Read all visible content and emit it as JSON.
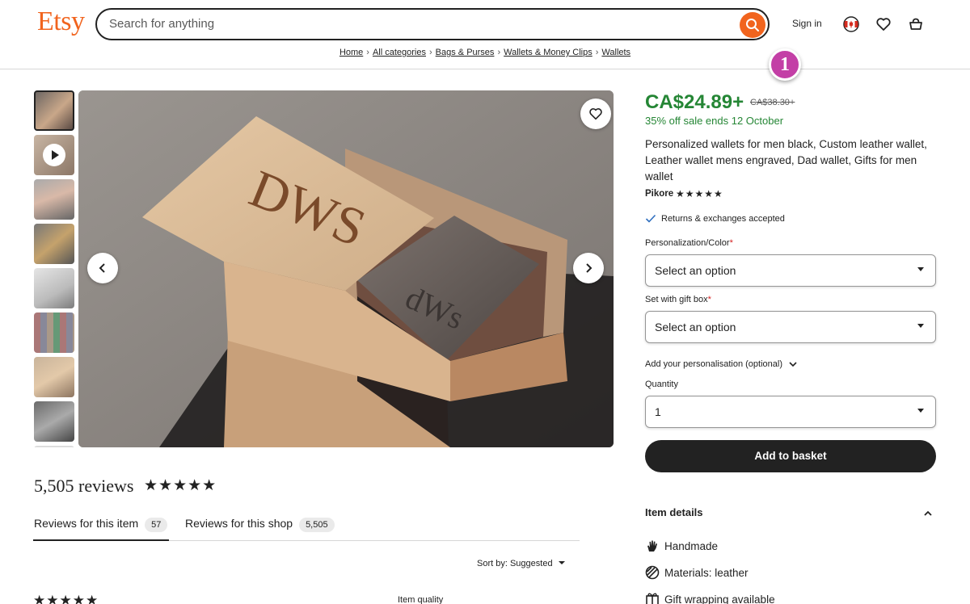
{
  "header": {
    "logo": "Etsy",
    "search_placeholder": "Search for anything",
    "signin": "Sign in"
  },
  "breadcrumb": [
    "Home",
    "All categories",
    "Bags & Purses",
    "Wallets & Money Clips",
    "Wallets"
  ],
  "marker_label": "1",
  "product": {
    "price": "CA$24.89+",
    "original_price": "CA$38.30+",
    "sale_text": "35% off sale ends 12 October",
    "title": "Personalized wallets for men black, Custom leather wallet, Leather wallet mens engraved, Dad wallet, Gifts for men wallet",
    "seller": "Pikore",
    "seller_stars": "★★★★★",
    "returns": "Returns & exchanges accepted",
    "engraving_text": "DWS",
    "wallet_text": "dWs"
  },
  "options": {
    "personalization_label": "Personalization/Color",
    "personalization_value": "Select an option",
    "gift_box_label": "Set with gift box",
    "gift_box_value": "Select an option",
    "add_personalisation": "Add your personalisation (optional)",
    "quantity_label": "Quantity",
    "quantity_value": "1",
    "required_mark": "*",
    "add_to_basket": "Add to basket"
  },
  "item_details": {
    "heading": "Item details",
    "items": [
      "Handmade",
      "Materials: leather",
      "Gift wrapping available"
    ]
  },
  "reviews": {
    "count_text": "5,505 reviews",
    "stars": "★★★★★",
    "tab_item": "Reviews for this item",
    "tab_item_count": "57",
    "tab_shop": "Reviews for this shop",
    "tab_shop_count": "5,505",
    "sort_by": "Sort by: Suggested",
    "item_quality": "Item quality"
  },
  "colors": {
    "brand": "#f1641e",
    "price_green": "#258635",
    "marker": "#c33fa6",
    "button_dark": "#222222"
  },
  "icons": [
    "search-icon",
    "canada-flag-icon",
    "heart-icon",
    "basket-icon",
    "play-icon",
    "chevron-left-icon",
    "chevron-right-icon",
    "check-icon",
    "chevron-down-icon",
    "chevron-up-icon",
    "hand-icon",
    "materials-icon",
    "gift-icon"
  ]
}
